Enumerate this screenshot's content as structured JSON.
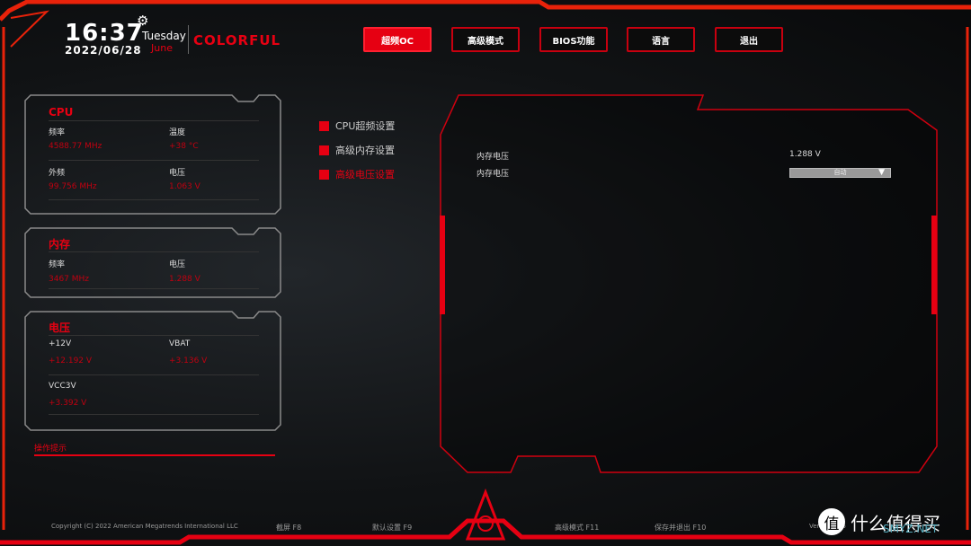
{
  "header": {
    "time": "16:37",
    "date": "2022/06/28",
    "day": "Tuesday",
    "month": "June",
    "brand": "COLORFUL",
    "settings_icon": "gear-icon"
  },
  "tabs": [
    {
      "label": "超频OC",
      "active": true
    },
    {
      "label": "高级模式"
    },
    {
      "label": "BIOS功能"
    },
    {
      "label": "语言"
    },
    {
      "label": "退出"
    }
  ],
  "cpu": {
    "title": "CPU",
    "items": [
      {
        "label": "频率",
        "value": "4588.77 MHz"
      },
      {
        "label": "温度",
        "value": "+38 °C"
      },
      {
        "label": "外频",
        "value": "99.756 MHz"
      },
      {
        "label": "电压",
        "value": "1.063 V"
      }
    ]
  },
  "memory": {
    "title": "内存",
    "items": [
      {
        "label": "频率",
        "value": "3467 MHz"
      },
      {
        "label": "电压",
        "value": "1.288 V"
      }
    ]
  },
  "voltage": {
    "title": "电压",
    "items": [
      {
        "label": "+12V",
        "value": "+12.192 V"
      },
      {
        "label": "VBAT",
        "value": "+3.136 V"
      },
      {
        "label": "VCC3V",
        "value": "+3.392 V"
      }
    ]
  },
  "menu": [
    {
      "label": "CPU超频设置"
    },
    {
      "label": "高级内存设置"
    },
    {
      "label": "高级电压设置",
      "selected": true
    }
  ],
  "settings": [
    {
      "label": "内存电压",
      "value": "1.288 V"
    },
    {
      "label": "内存电压",
      "dropdown": "自动"
    }
  ],
  "hint_title": "操作提示",
  "footer": {
    "copyright": "Copyright (C) 2022 American Megatrends International LLC",
    "keys": [
      "截屏 F8",
      "默认设置 F9",
      "高级模式 F11",
      "保存并退出 F10"
    ],
    "version": "Ver… : 1.26"
  },
  "watermark": {
    "text": "什么值得买",
    "badge": "值",
    "sub": "SMYZ.NET"
  },
  "colors": {
    "accent": "#e60012",
    "background": "#0d0f11"
  }
}
